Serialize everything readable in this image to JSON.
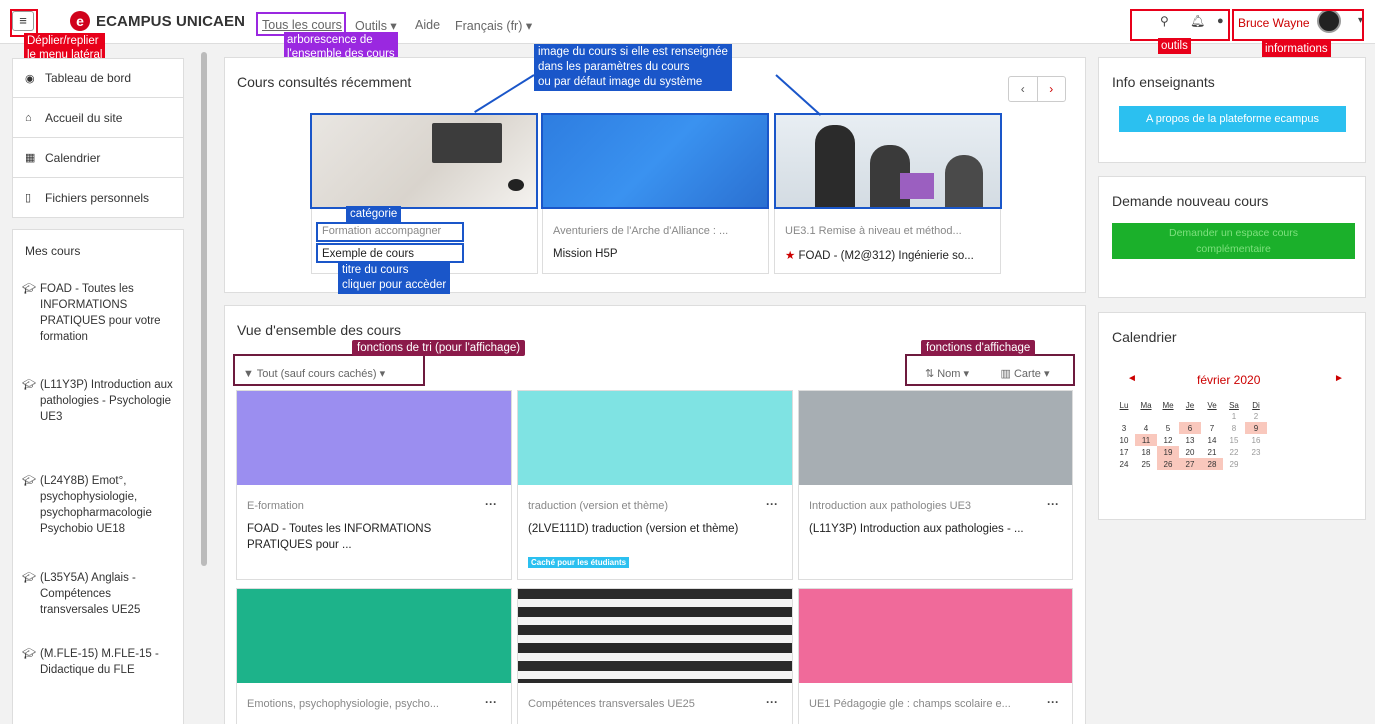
{
  "topbar": {
    "brand": "ECAMPUS UNICAEN",
    "nav_all_courses": "Tous les cours",
    "nav_tools": "Outils",
    "nav_help": "Aide",
    "nav_language": "Français (fr)",
    "user_name": "Bruce Wayne"
  },
  "annotations": {
    "menu": "Déplier/replier\nle menu latéral",
    "arborescence": "arborescence de\nl'ensemble des cours",
    "image": "image du cours si elle est renseignée\ndans les paramètres du cours\nou par défaut image du système",
    "outils": "outils",
    "profil": "informations\nde profil",
    "categorie": "catégorie",
    "titre": "titre du cours\ncliquer pour accèder",
    "tri": "fonctions de tri (pour l'affichage)",
    "affichage": "fonctions d'affichage"
  },
  "sidebar": {
    "items": [
      "Tableau de bord",
      "Accueil du site",
      "Calendrier",
      "Fichiers personnels"
    ],
    "mes_cours": "Mes cours",
    "courses": [
      "FOAD - Toutes les INFORMATIONS PRATIQUES pour votre formation",
      "(L11Y3P) Introduction aux pathologies - Psychologie UE3",
      "(L24Y8B) Emot°, psychophysiologie, psychopharmacologie Psychobio UE18",
      "(L35Y5A) Anglais - Compétences transversales UE25",
      "(M.FLE-15) M.FLE-15 - Didactique du FLE"
    ]
  },
  "recent": {
    "title": "Cours consultés récemment",
    "cards": [
      {
        "category": "Formation accompagner",
        "title": "Exemple de cours"
      },
      {
        "category": "Aventuriers de l'Arche d'Alliance : ...",
        "title": "Mission H5P"
      },
      {
        "category": "UE3.1 Remise à niveau et méthod...",
        "title": "FOAD - (M2@312) Ingénierie so..."
      }
    ]
  },
  "overview": {
    "title": "Vue d'ensemble des cours",
    "filter": "Tout (sauf cours cachés)",
    "sort": "Nom",
    "view": "Carte",
    "cards": [
      {
        "category": "E-formation",
        "title": "FOAD - Toutes les INFORMATIONS PRATIQUES pour ...",
        "color": "#9b8ef0"
      },
      {
        "category": "traduction (version et thème)",
        "title": "(2LVE111D) traduction (version et thème)",
        "badge": "Caché pour les étudiants",
        "color": "#7fe3e3"
      },
      {
        "category": "Introduction aux pathologies UE3",
        "title": "(L11Y3P) Introduction aux pathologies - ...",
        "color": "#a7aeb3"
      },
      {
        "category": "Emotions, psychophysiologie, psycho...",
        "title": "",
        "color": "#1db38a"
      },
      {
        "category": "Compétences transversales UE25",
        "title": "",
        "color": "#2a2a2a"
      },
      {
        "category": "UE1 Pédagogie gle : champs scolaire e...",
        "title": "",
        "color": "#f06a9a"
      }
    ]
  },
  "right": {
    "info_title": "Info enseignants",
    "info_button": "A propos de la plateforme ecampus",
    "demande_title": "Demande nouveau cours",
    "demande_button": "Demander un espace cours complémentaire",
    "cal_title": "Calendrier",
    "cal_month": "février 2020",
    "cal_days": [
      "Lu",
      "Ma",
      "Me",
      "Je",
      "Ve",
      "Sa",
      "Di"
    ]
  },
  "colors": {
    "accent": "#d0021b",
    "info": "#2bc0f0",
    "demande": "#1bb02b"
  }
}
